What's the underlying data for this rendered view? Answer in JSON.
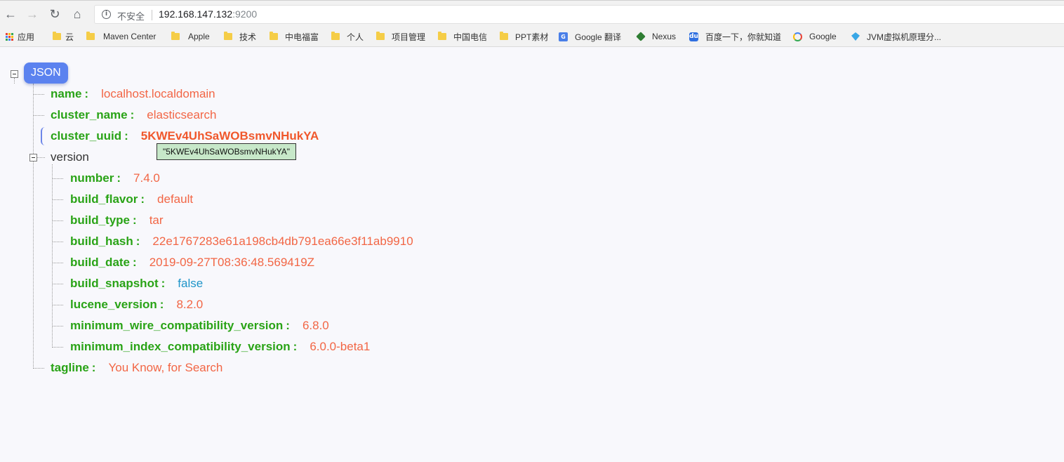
{
  "browser": {
    "security_label": "不安全",
    "url_host": "192.168.147.132",
    "url_port": ":9200"
  },
  "bookmarks": [
    {
      "label": "应用",
      "icon": "apps-grid-icon"
    },
    {
      "label": "云",
      "icon": "folder-icon"
    },
    {
      "label": "Maven Center",
      "icon": "folder-icon"
    },
    {
      "label": "Apple",
      "icon": "folder-icon"
    },
    {
      "label": "技术",
      "icon": "folder-icon"
    },
    {
      "label": "中电福富",
      "icon": "folder-icon"
    },
    {
      "label": "个人",
      "icon": "folder-icon"
    },
    {
      "label": "项目管理",
      "icon": "folder-icon"
    },
    {
      "label": "中国电信",
      "icon": "folder-icon"
    },
    {
      "label": "PPT素材",
      "icon": "folder-icon"
    },
    {
      "label": "Google 翻译",
      "icon": "google-translate-icon"
    },
    {
      "label": "Nexus",
      "icon": "nexus-icon"
    },
    {
      "label": "百度一下，你就知道",
      "icon": "baidu-icon"
    },
    {
      "label": "Google",
      "icon": "google-icon"
    },
    {
      "label": "JVM虚拟机原理分...",
      "icon": "jvm-icon"
    }
  ],
  "json_viewer": {
    "root_label": "JSON",
    "fields": [
      {
        "key": "name",
        "value": "localhost.localdomain"
      },
      {
        "key": "cluster_name",
        "value": "elasticsearch"
      },
      {
        "key": "cluster_uuid",
        "value": "5KWEv4UhSaWOBsmvNHukYA"
      },
      {
        "key": "version"
      },
      {
        "key": "tagline",
        "value": "You Know, for Search"
      }
    ],
    "version_fields": [
      {
        "key": "number",
        "value": "7.4.0"
      },
      {
        "key": "build_flavor",
        "value": "default"
      },
      {
        "key": "build_type",
        "value": "tar"
      },
      {
        "key": "build_hash",
        "value": "22e1767283e61a198cb4db791ea66e3f11ab9910"
      },
      {
        "key": "build_date",
        "value": "2019-09-27T08:36:48.569419Z"
      },
      {
        "key": "build_snapshot",
        "value": "false"
      },
      {
        "key": "lucene_version",
        "value": "8.2.0"
      },
      {
        "key": "minimum_wire_compatibility_version",
        "value": "6.8.0"
      },
      {
        "key": "minimum_index_compatibility_version",
        "value": "6.0.0-beta1"
      }
    ],
    "colon": ":",
    "tooltip": "\"5KWEv4UhSaWOBsmvNHukYA\""
  },
  "colors": {
    "key": "#29a316",
    "string_value": "#f26645",
    "boolean_value": "#1f95c9",
    "root_badge": "#5b82ef"
  }
}
